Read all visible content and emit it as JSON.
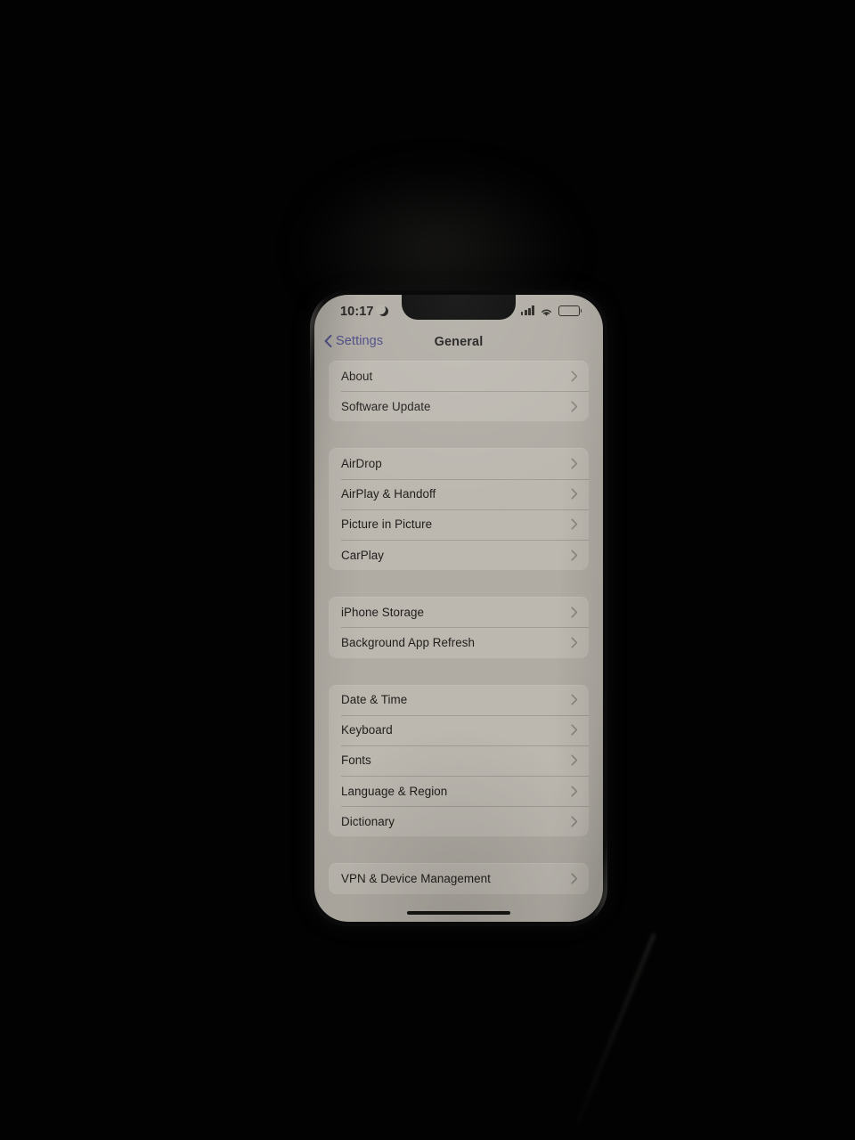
{
  "device": {
    "status_bar": {
      "time": "10:17",
      "moon_icon": "moon-icon",
      "signal_icon": "cellular-signal-icon",
      "wifi_icon": "wifi-icon",
      "battery_icon": "battery-icon"
    },
    "nav": {
      "back_label": "Settings",
      "back_icon": "chevron-left-icon",
      "title": "General"
    },
    "home_indicator": "home-indicator"
  },
  "settings": {
    "sections": [
      {
        "rows": [
          {
            "label": "About"
          },
          {
            "label": "Software Update"
          }
        ]
      },
      {
        "rows": [
          {
            "label": "AirDrop"
          },
          {
            "label": "AirPlay & Handoff"
          },
          {
            "label": "Picture in Picture"
          },
          {
            "label": "CarPlay"
          }
        ]
      },
      {
        "rows": [
          {
            "label": "iPhone Storage"
          },
          {
            "label": "Background App Refresh"
          }
        ]
      },
      {
        "rows": [
          {
            "label": "Date & Time"
          },
          {
            "label": "Keyboard"
          },
          {
            "label": "Fonts"
          },
          {
            "label": "Language & Region"
          },
          {
            "label": "Dictionary"
          }
        ]
      },
      {
        "rows": [
          {
            "label": "VPN & Device Management"
          }
        ]
      }
    ]
  },
  "colors": {
    "backdrop": "#000000",
    "screen_background": "#b0aca4",
    "section_background": "#bcb8b0",
    "primary_text": "#1f1d1b",
    "accent_blue": "#4b4a85",
    "chevron": "#6d6960"
  }
}
